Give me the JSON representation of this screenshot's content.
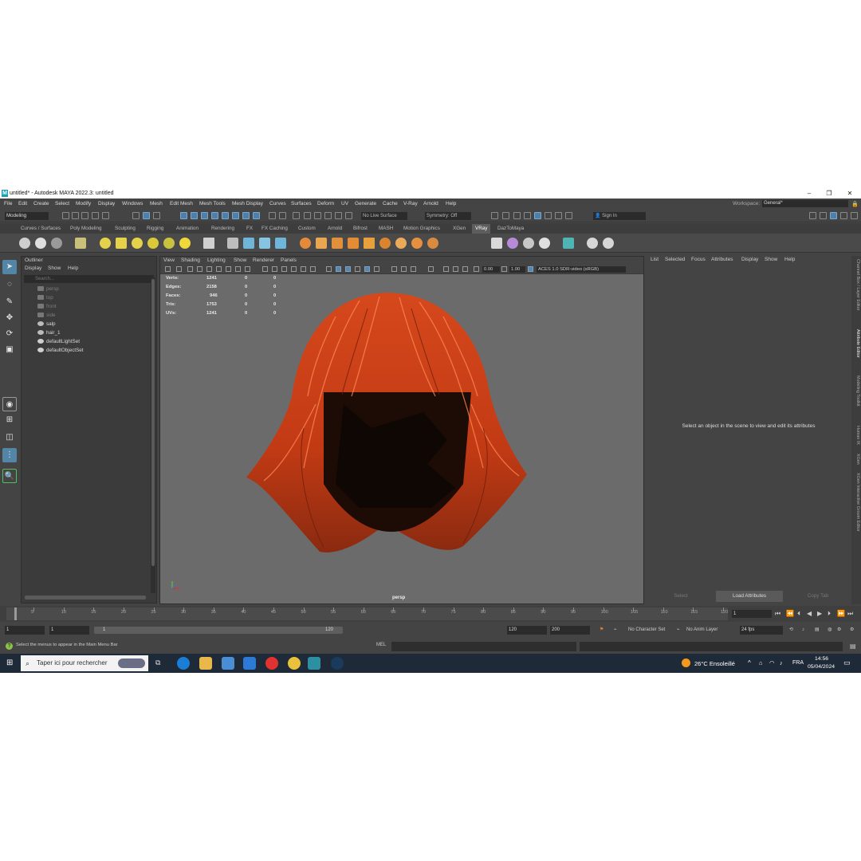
{
  "window": {
    "title": "untitled* - Autodesk MAYA 2022.3: untitled",
    "logo_letter": "M",
    "buttons": {
      "minimize": "–",
      "restore": "❐",
      "close": "✕"
    }
  },
  "menubar": {
    "items": [
      "File",
      "Edit",
      "Create",
      "Select",
      "Modify",
      "Display",
      "Windows",
      "Mesh",
      "Edit Mesh",
      "Mesh Tools",
      "Mesh Display",
      "Curves",
      "Surfaces",
      "Deform",
      "UV",
      "Generate",
      "Cache",
      "V-Ray",
      "Arnold",
      "Help"
    ],
    "workspace_label": "Workspace:",
    "workspace_value": "General*"
  },
  "statusline": {
    "mode": "Modeling",
    "live_surface": "No Live Surface",
    "symmetry": "Symmetry: Off",
    "sign_in": "Sign In"
  },
  "shelf": {
    "tabs": [
      "Curves / Surfaces",
      "Poly Modeling",
      "Sculpting",
      "Rigging",
      "Animation",
      "Rendering",
      "FX",
      "FX Caching",
      "Custom",
      "Arnold",
      "Bifrost",
      "MASH",
      "Motion Graphics",
      "XGen",
      "VRay",
      "DazToMaya"
    ],
    "active_tab": "VRay"
  },
  "outliner": {
    "title": "Outliner",
    "menus": [
      "Display",
      "Show",
      "Help"
    ],
    "search_placeholder": "Search...",
    "items": [
      {
        "label": "persp",
        "dim": true,
        "icon": "camera-icon"
      },
      {
        "label": "top",
        "dim": true,
        "icon": "camera-icon"
      },
      {
        "label": "front",
        "dim": true,
        "icon": "camera-icon"
      },
      {
        "label": "side",
        "dim": true,
        "icon": "camera-icon"
      },
      {
        "label": "salp",
        "dim": false,
        "icon": "transform-icon"
      },
      {
        "label": "hair_1",
        "dim": false,
        "icon": "transform-icon"
      },
      {
        "label": "defaultLightSet",
        "dim": false,
        "icon": "set-icon"
      },
      {
        "label": "defaultObjectSet",
        "dim": false,
        "icon": "set-icon"
      }
    ]
  },
  "viewport": {
    "menus": [
      "View",
      "Shading",
      "Lighting",
      "Show",
      "Renderer",
      "Panels"
    ],
    "exposure": "0.00",
    "gamma": "1.00",
    "color_space": "ACES 1.0 SDR-video (sRGB)",
    "camera": "persp",
    "hud": [
      {
        "label": "Verts:",
        "a": "1241",
        "b": "0",
        "c": "0"
      },
      {
        "label": "Edges:",
        "a": "2158",
        "b": "0",
        "c": "0"
      },
      {
        "label": "Faces:",
        "a": "946",
        "b": "0",
        "c": "0"
      },
      {
        "label": "Tris:",
        "a": "1753",
        "b": "0",
        "c": "0"
      },
      {
        "label": "UVs:",
        "a": "1241",
        "b": "0",
        "c": "0"
      }
    ],
    "hair_color": "#c8401a"
  },
  "attribute_editor": {
    "menus": [
      "List",
      "Selected",
      "Focus",
      "Attributes",
      "Display",
      "Show",
      "Help"
    ],
    "message": "Select an object in the scene to view and edit its attributes",
    "buttons": [
      "Select",
      "Load Attributes",
      "Copy Tab"
    ]
  },
  "side_tabs": [
    "Channel Box / Layer Editor",
    "Attribute Editor",
    "Modeling Toolkit",
    "Human IK",
    "XGen",
    "XGen Interactive Groom Editor"
  ],
  "timeline": {
    "ticks": [
      "5",
      "10",
      "15",
      "20",
      "25",
      "30",
      "35",
      "40",
      "45",
      "50",
      "55",
      "60",
      "65",
      "70",
      "75",
      "80",
      "85",
      "90",
      "95",
      "100",
      "105",
      "110",
      "115",
      "120"
    ],
    "current_frame": "1"
  },
  "range": {
    "start": "1",
    "playback_start": "1",
    "bar_start": "1",
    "bar_end": "120",
    "playback_end": "120",
    "end": "200",
    "character_set": "No Character Set",
    "anim_layer": "No Anim Layer",
    "fps": "24 fps"
  },
  "command_line": {
    "help": "Select the menus to appear in the Main Menu Bar",
    "language": "MEL"
  },
  "taskbar": {
    "search_placeholder": "Taper ici pour rechercher",
    "weather": "26°C  Ensoleillé",
    "language": "FRA",
    "time": "14:56",
    "date": "05/04/2024"
  }
}
